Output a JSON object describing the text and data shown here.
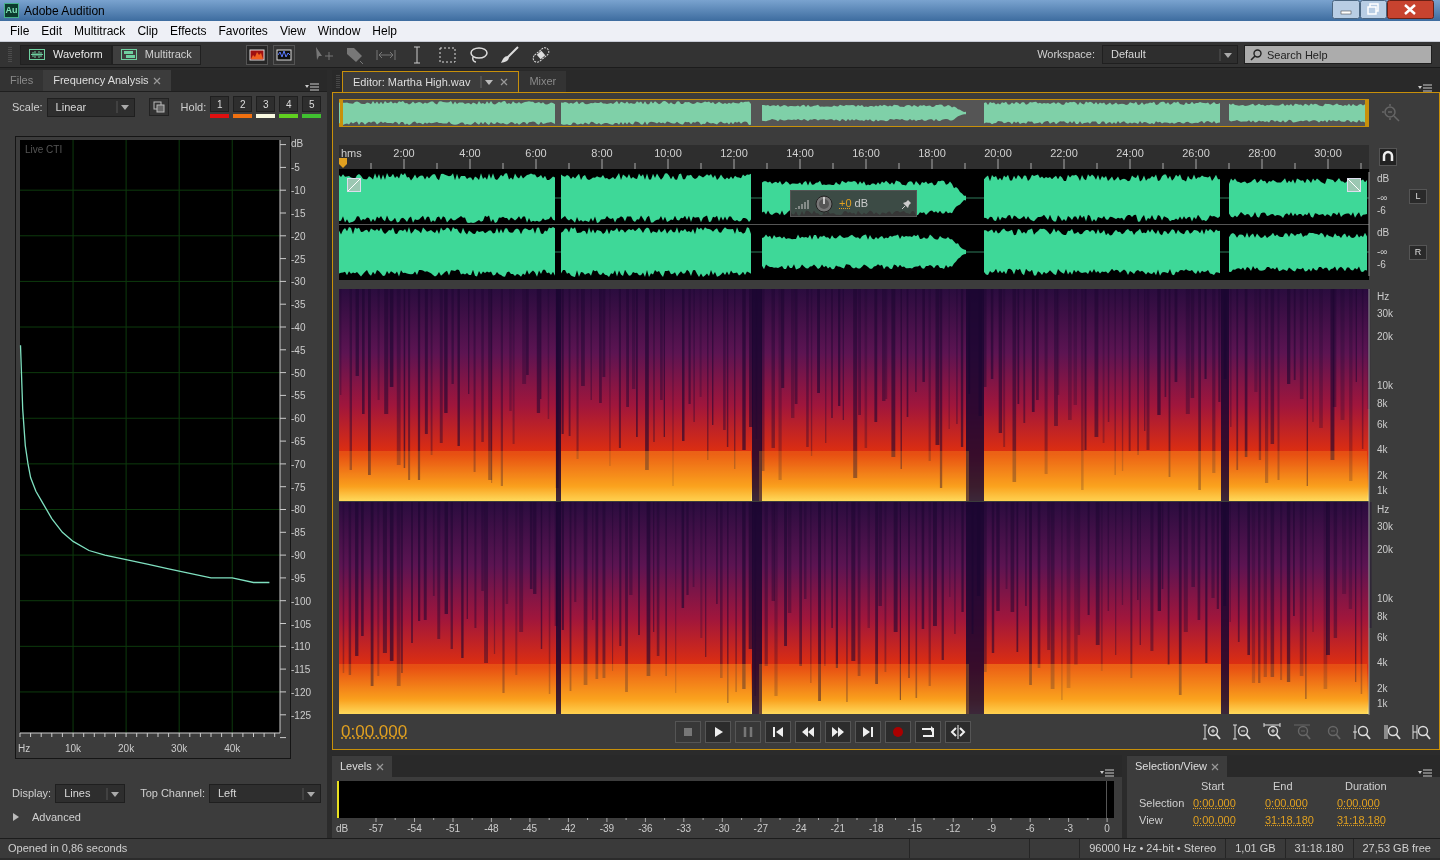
{
  "window": {
    "title": "Adobe Audition",
    "app_icon": "Au"
  },
  "menu": [
    "File",
    "Edit",
    "Multitrack",
    "Clip",
    "Effects",
    "Favorites",
    "View",
    "Window",
    "Help"
  ],
  "toolbar": {
    "views": [
      {
        "label": "Waveform",
        "selected": true
      },
      {
        "label": "Multitrack",
        "selected": false
      }
    ],
    "workspace_label": "Workspace:",
    "workspace": "Default",
    "search_placeholder": "Search Help"
  },
  "left_panel": {
    "tabs": [
      {
        "label": "Files",
        "selected": false
      },
      {
        "label": "Frequency Analysis",
        "selected": true
      }
    ],
    "scale_label": "Scale:",
    "scale": "Linear",
    "hold_label": "Hold:",
    "holds": [
      {
        "label": "1",
        "color": "#e01010"
      },
      {
        "label": "2",
        "color": "#f07010"
      },
      {
        "label": "3",
        "color": "#f8f8e0"
      },
      {
        "label": "4",
        "color": "#60d020"
      },
      {
        "label": "5",
        "color": "#40c030"
      }
    ],
    "plot_label": "Live CTI",
    "chart_data": {
      "type": "line",
      "xlabel": "Hz",
      "ylabel": "dB",
      "x": [
        100,
        500,
        1000,
        1500,
        2000,
        3000,
        4000,
        6000,
        8000,
        10000,
        13000,
        16000,
        20000,
        24000,
        28000,
        32000,
        36000,
        40000,
        44000,
        47000
      ],
      "grid": true,
      "series": [
        {
          "color": "#7fe0c0",
          "values": [
            -44,
            -58,
            -66,
            -70,
            -73,
            -76,
            -78,
            -82,
            -85,
            -87,
            -89,
            -90,
            -91,
            -92,
            -93,
            -94,
            -95,
            -95,
            -96,
            -96
          ]
        }
      ],
      "xlim": [
        0,
        49000
      ],
      "ylim": [
        -129,
        1
      ],
      "xticks": [
        {
          "value": 10000,
          "label": "10k"
        },
        {
          "value": 20000,
          "label": "20k"
        },
        {
          "value": 30000,
          "label": "30k"
        },
        {
          "value": 40000,
          "label": "40k"
        }
      ],
      "yticks": [
        -5,
        -10,
        -15,
        -20,
        -25,
        -30,
        -35,
        -40,
        -45,
        -50,
        -55,
        -60,
        -65,
        -70,
        -75,
        -80,
        -85,
        -90,
        -95,
        -100,
        -105,
        -110,
        -115,
        -120,
        -125
      ]
    },
    "display_label": "Display:",
    "display": "Lines",
    "top_channel_label": "Top Channel:",
    "top_channel": "Left",
    "advanced": {
      "label": "Advanced",
      "expanded": false
    }
  },
  "editor": {
    "tabs": [
      {
        "label": "Editor: Martha High.wav",
        "selected": true
      },
      {
        "label": "Mixer",
        "selected": false
      }
    ],
    "timeline": [
      "hms",
      "2:00",
      "4:00",
      "6:00",
      "8:00",
      "10:00",
      "12:00",
      "14:00",
      "16:00",
      "18:00",
      "20:00",
      "22:00",
      "24:00",
      "26:00",
      "28:00",
      "30:00"
    ],
    "waveform_channels": [
      {
        "channel": "L",
        "scale": [
          "dB",
          "-∞",
          "-6"
        ]
      },
      {
        "channel": "R",
        "scale": [
          "dB",
          "-∞",
          "-6"
        ]
      }
    ],
    "gain": "+0",
    "gain_unit": "dB",
    "spectral_channels": [
      {
        "scale": [
          "Hz",
          "30k",
          "20k",
          "10k",
          "8k",
          "6k",
          "4k",
          "2k",
          "1k"
        ]
      },
      {
        "scale": [
          "Hz",
          "30k",
          "20k",
          "10k",
          "8k",
          "6k",
          "4k",
          "2k",
          "1k"
        ]
      }
    ],
    "time": "0:00.000"
  },
  "levels": {
    "tab": "Levels",
    "scale": [
      "dB",
      "-57",
      "-54",
      "-51",
      "-48",
      "-45",
      "-42",
      "-39",
      "-36",
      "-33",
      "-30",
      "-27",
      "-24",
      "-21",
      "-18",
      "-15",
      "-12",
      "-9",
      "-6",
      "-3",
      "0"
    ]
  },
  "selection_view": {
    "tab": "Selection/View",
    "columns": [
      "Start",
      "End",
      "Duration"
    ],
    "rows": [
      {
        "label": "Selection",
        "values": [
          "0:00.000",
          "0:00.000",
          "0:00.000"
        ]
      },
      {
        "label": "View",
        "values": [
          "0:00.000",
          "31:18.180",
          "31:18.180"
        ]
      }
    ]
  },
  "status_bar": {
    "message": "Opened in 0,86 seconds",
    "format": "96000 Hz • 24-bit • Stereo",
    "size": "1,01 GB",
    "duration": "31:18.180",
    "free": "27,53 GB free"
  }
}
